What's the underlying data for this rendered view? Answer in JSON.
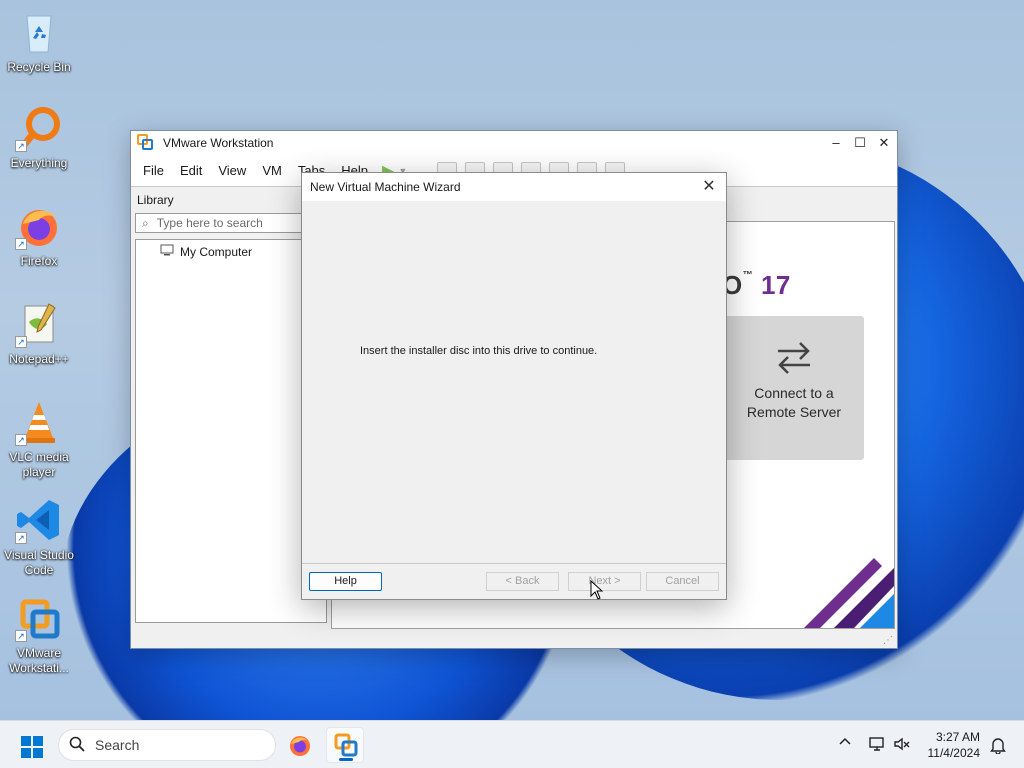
{
  "desktop": {
    "icons": [
      {
        "label": "Recycle Bin"
      },
      {
        "label": "Everything"
      },
      {
        "label": "Firefox"
      },
      {
        "label": "Notepad++"
      },
      {
        "label": "VLC media player"
      },
      {
        "label": "Visual Studio Code"
      },
      {
        "label": "VMware Workstati..."
      }
    ]
  },
  "vmware": {
    "title": "VMware Workstation",
    "menu": [
      "File",
      "Edit",
      "View",
      "VM",
      "Tabs",
      "Help"
    ],
    "library": {
      "title": "Library",
      "search_placeholder": "Type here to search",
      "tree": [
        "My Computer"
      ]
    },
    "home": {
      "version": "17",
      "card_label": "Connect to a Remote Server"
    }
  },
  "wizard": {
    "title": "New Virtual Machine Wizard",
    "message": "Insert the installer disc into this drive to continue.",
    "buttons": {
      "help": "Help",
      "back": "< Back",
      "next": "Next >",
      "cancel": "Cancel"
    }
  },
  "taskbar": {
    "search_label": "Search",
    "time": "3:27 AM",
    "date": "11/4/2024"
  },
  "colors": {
    "accent": "#0067c0",
    "vmware_purple": "#6e2d8f"
  }
}
